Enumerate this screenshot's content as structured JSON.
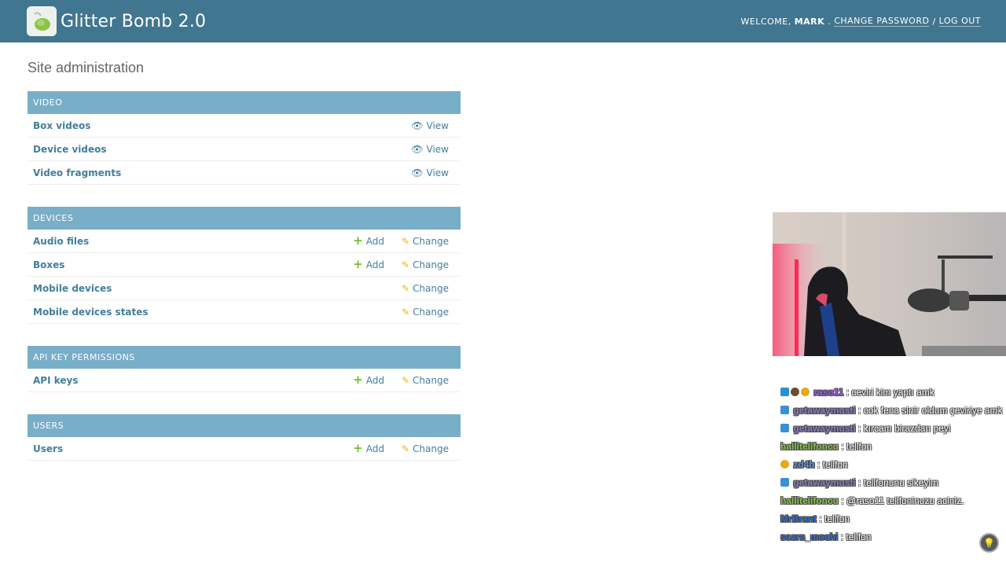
{
  "header": {
    "site_name": "Glitter Bomb 2.0",
    "welcome": "WELCOME,",
    "user": "MARK",
    "change_password": "CHANGE PASSWORD",
    "separator": "/",
    "logout": "LOG OUT"
  },
  "page": {
    "title": "Site administration"
  },
  "modules": [
    {
      "caption": "VIDEO",
      "rows": [
        {
          "name": "Box videos",
          "view": "View"
        },
        {
          "name": "Device videos",
          "view": "View"
        },
        {
          "name": "Video fragments",
          "view": "View"
        }
      ]
    },
    {
      "caption": "DEVICES",
      "rows": [
        {
          "name": "Audio files",
          "add": "Add",
          "change": "Change"
        },
        {
          "name": "Boxes",
          "add": "Add",
          "change": "Change"
        },
        {
          "name": "Mobile devices",
          "change": "Change"
        },
        {
          "name": "Mobile devices states",
          "change": "Change"
        }
      ]
    },
    {
      "caption": "API KEY PERMISSIONS",
      "rows": [
        {
          "name": "API keys",
          "add": "Add",
          "change": "Change"
        }
      ]
    },
    {
      "caption": "USERS",
      "rows": [
        {
          "name": "Users",
          "add": "Add",
          "change": "Change"
        }
      ]
    }
  ],
  "chat": {
    "messages": [
      {
        "user": "raso11",
        "sep": ":",
        "text": "ceviri kim yaptı amk",
        "color": "#9b5de5"
      },
      {
        "user": "getawaymusti",
        "sep": ":",
        "text": "cok fena sinir oldum çeviriye amk",
        "color": "#8e7cc3"
      },
      {
        "user": "getawaymusti",
        "sep": ":",
        "text": "kırcam birazdan peyi",
        "color": "#8e7cc3"
      },
      {
        "user": "hallitelifoncu",
        "sep": ":",
        "text": "telifon",
        "color": "#8bc34a"
      },
      {
        "user": "zd4h",
        "sep": ":",
        "text": "telifon",
        "color": "#5b8fd9"
      },
      {
        "user": "getawaymusti",
        "sep": ":",
        "text": "telifonunu sikeyim",
        "color": "#8e7cc3"
      },
      {
        "user": "hallitelifoncu",
        "sep": ":",
        "text": "@raso11 telifoninuzu aciniz.",
        "color": "#8bc34a"
      },
      {
        "user": "MrBrant",
        "sep": ":",
        "text": "telifon",
        "color": "#2f6fd6"
      },
      {
        "user": "scara_mochi",
        "sep": ":",
        "text": "telifon",
        "color": "#2f6fd6"
      }
    ]
  },
  "colors": {
    "header_bg": "#417690",
    "module_caption_bg": "#79aec8",
    "link": "#447e9b",
    "add": "#70bf2b",
    "change": "#efb80b"
  }
}
